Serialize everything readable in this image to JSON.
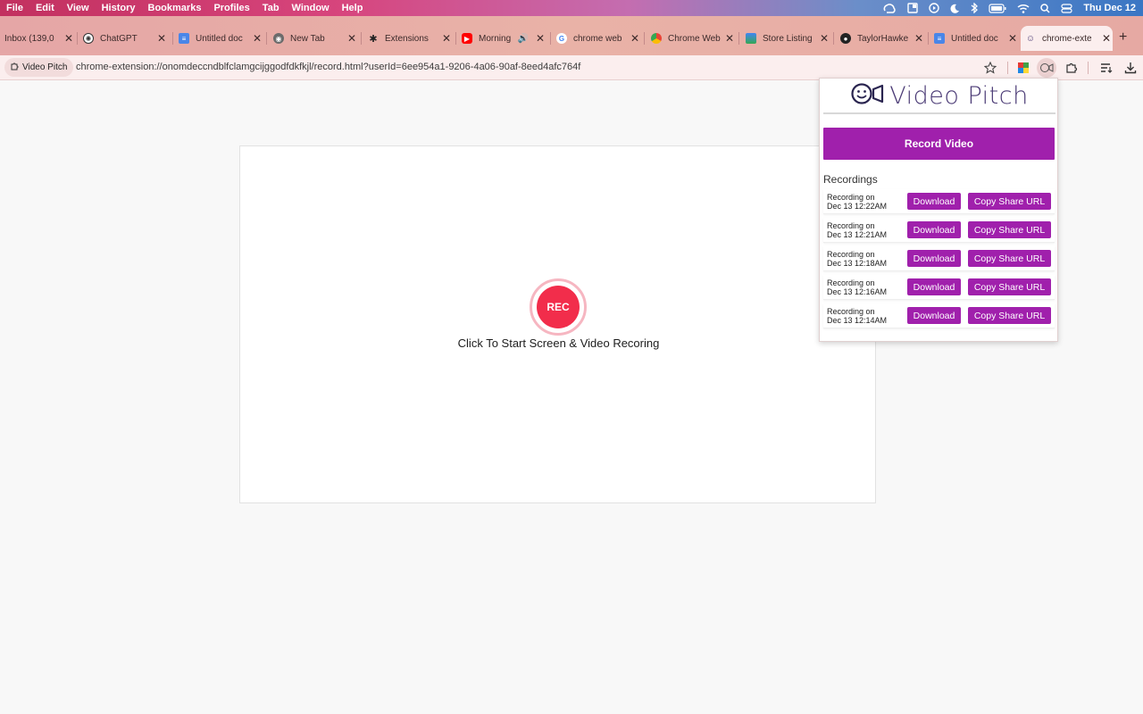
{
  "menubar": {
    "items": [
      "File",
      "Edit",
      "View",
      "History",
      "Bookmarks",
      "Profiles",
      "Tab",
      "Window",
      "Help"
    ],
    "clock": "Thu Dec 12"
  },
  "tabs": [
    {
      "label": "Inbox (139,0",
      "icon": "mail-icon"
    },
    {
      "label": "ChatGPT",
      "icon": "chatgpt-icon"
    },
    {
      "label": "Untitled doc",
      "icon": "docs-icon"
    },
    {
      "label": "New Tab",
      "icon": "chrome-icon"
    },
    {
      "label": "Extensions",
      "icon": "puzzle-icon"
    },
    {
      "label": "Morning",
      "icon": "youtube-icon"
    },
    {
      "label": "chrome web",
      "icon": "google-icon"
    },
    {
      "label": "Chrome Web",
      "icon": "chrome-icon"
    },
    {
      "label": "Store Listing",
      "icon": "store-icon"
    },
    {
      "label": "TaylorHawke",
      "icon": "github-icon"
    },
    {
      "label": "Untitled doc",
      "icon": "docs-icon"
    },
    {
      "label": "chrome-exte",
      "icon": "video-pitch-icon"
    }
  ],
  "toolbar": {
    "extension_chip": "Video Pitch",
    "url": "chrome-extension://onomdeccndblfclamgcijggodfdkfkjl/record.html?userId=6ee954a1-9206-4a06-90af-8eed4afc764f"
  },
  "recorder": {
    "rec_label": "REC",
    "caption": "Click To Start Screen & Video Recoring"
  },
  "popup": {
    "brand": "Video Pitch",
    "record_button": "Record Video",
    "recordings_heading": "Recordings",
    "download_label": "Download",
    "copy_label": "Copy Share URL",
    "recordings": [
      {
        "prefix": "Recording on",
        "date": "Dec 13 12:22AM"
      },
      {
        "prefix": "Recording on",
        "date": "Dec 13 12:21AM"
      },
      {
        "prefix": "Recording on",
        "date": "Dec 13 12:18AM"
      },
      {
        "prefix": "Recording on",
        "date": "Dec 13 12:16AM"
      },
      {
        "prefix": "Recording on",
        "date": "Dec 13 12:14AM"
      }
    ]
  },
  "colors": {
    "accent": "#a020ac",
    "rec_red": "#f22d4b",
    "brand_purple": "#4a3a75"
  }
}
